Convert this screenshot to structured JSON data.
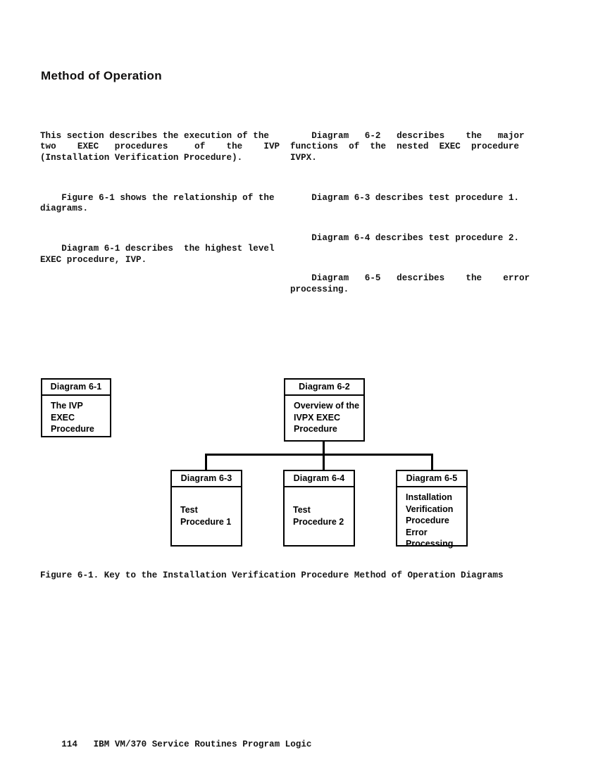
{
  "page": {
    "heading": "Method of Operation",
    "footer_page_number": "114",
    "footer_title": "IBM VM/370 Service Routines Program Logic",
    "caption": "Figure 6-1. Key to the Installation Verification Procedure Method of Operation Diagrams"
  },
  "body": {
    "left_column": [
      "This section describes the execution of the\ntwo    EXEC   procedures     of    the    IVP\n(Installation Verification Procedure).",
      "    Figure 6-1 shows the relationship of the\ndiagrams.",
      "    Diagram 6-1 describes  the highest level\nEXEC procedure, IVP."
    ],
    "right_column": [
      "    Diagram   6-2   describes    the   major\nfunctions  of  the  nested  EXEC  procedure\nIVPX.",
      "    Diagram 6-3 describes test procedure 1.",
      "    Diagram 6-4 describes test procedure 2.",
      "    Diagram   6-5   describes    the    error\nprocessing."
    ]
  },
  "figure": {
    "boxes": [
      {
        "id": "6-1",
        "header": "Diagram 6-1",
        "body": "The IVP\nEXEC\nProcedure"
      },
      {
        "id": "6-2",
        "header": "Diagram 6-2",
        "body": "Overview of the\nIVPX EXEC\nProcedure"
      },
      {
        "id": "6-3",
        "header": "Diagram 6-3",
        "body": "Test\nProcedure 1"
      },
      {
        "id": "6-4",
        "header": "Diagram 6-4",
        "body": "Test\nProcedure 2"
      },
      {
        "id": "6-5",
        "header": "Diagram 6-5",
        "body": "Installation\nVerification\nProcedure\nError\nProcessing"
      }
    ]
  }
}
